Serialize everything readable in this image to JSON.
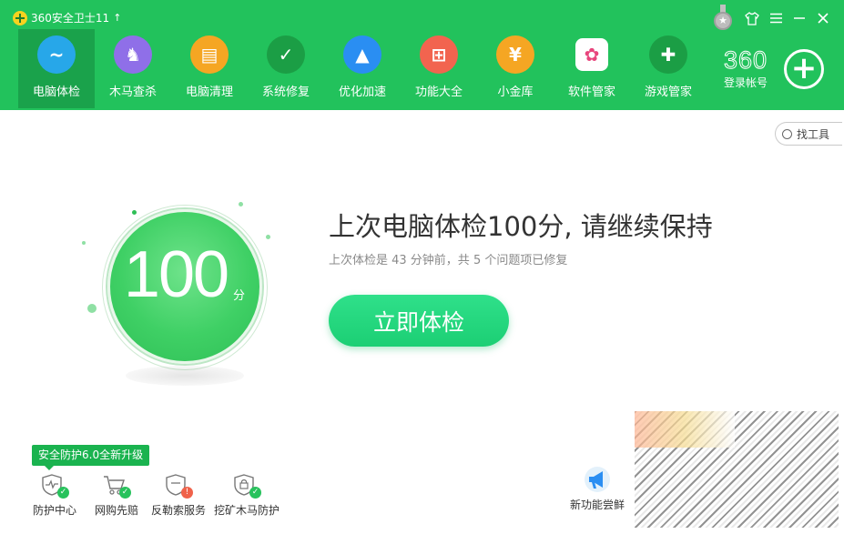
{
  "app": {
    "title": "360安全卫士11"
  },
  "colors": {
    "brand_green": "#22c25c",
    "active_tab": "#1aa24b",
    "button_green": "#22d87c"
  },
  "nav": {
    "items": [
      {
        "label": "电脑体检",
        "icon": "monitor-check-icon",
        "color": "#27a7e9",
        "glyph": "~"
      },
      {
        "label": "木马查杀",
        "icon": "horse-icon",
        "color": "#8f6fe8",
        "glyph": "♞"
      },
      {
        "label": "电脑清理",
        "icon": "broom-icon",
        "color": "#f5a623",
        "glyph": "▤"
      },
      {
        "label": "系统修复",
        "icon": "shield-icon",
        "color": "#1b9e45",
        "glyph": "✓"
      },
      {
        "label": "优化加速",
        "icon": "rocket-icon",
        "color": "#2a8ef2",
        "glyph": "▲"
      },
      {
        "label": "功能大全",
        "icon": "grid-icon",
        "color": "#f2644f",
        "glyph": "⊞"
      },
      {
        "label": "小金库",
        "icon": "money-bag-icon",
        "color": "#f5a623",
        "glyph": "¥"
      },
      {
        "label": "软件管家",
        "icon": "software-icon",
        "color": "#ffffff",
        "glyph": "✿"
      },
      {
        "label": "游戏管家",
        "icon": "gamepad-icon",
        "color": "#1b9e45",
        "glyph": "✚"
      }
    ]
  },
  "account": {
    "brand": "360",
    "login_label": "登录帐号"
  },
  "find_tools": {
    "label": "找工具"
  },
  "score": {
    "value": "100",
    "unit": "分"
  },
  "main": {
    "headline": "上次电脑体检100分, 请继续保持",
    "subline": "上次体检是 43 分钟前，共 5 个问题项已修复",
    "check_button": "立即体检"
  },
  "bottom": {
    "upgrade_tag": "安全防护6.0全新升级",
    "tools": [
      {
        "label": "防护中心",
        "icon": "shield-pulse-icon",
        "badge_color": "#27c25c"
      },
      {
        "label": "网购先赔",
        "icon": "cart-icon",
        "badge_color": "#27c25c"
      },
      {
        "label": "反勒索服务",
        "icon": "shield-warning-icon",
        "badge_color": "#f0624a"
      },
      {
        "label": "挖矿木马防护",
        "icon": "shield-lock-icon",
        "badge_color": "#27c25c"
      }
    ],
    "new_feature": {
      "label": "新功能尝鲜",
      "icon": "megaphone-icon"
    }
  }
}
